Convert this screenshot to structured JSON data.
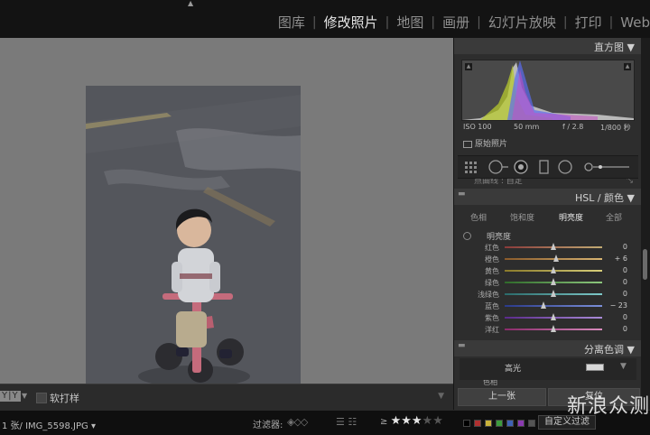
{
  "modules": [
    "图库",
    "修改照片",
    "地图",
    "画册",
    "幻灯片放映",
    "打印",
    "Web"
  ],
  "active_module": "修改照片",
  "toolbar": {
    "view_label": "Y|Y",
    "softproof_label": "软打样"
  },
  "filmstrip": {
    "file_info": "1 张/ IMG_5598.JPG",
    "filter_label": "过滤器:",
    "rating_op": "≥",
    "stars_on": 3,
    "stars_total": 5,
    "custom_filter": "自定义过滤",
    "label_colors": [
      "#000000",
      "#b03030",
      "#c9b23a",
      "#3d9b3d",
      "#3f62b5",
      "#8a3ab0",
      "#555555"
    ]
  },
  "histogram": {
    "panel_title": "直方图",
    "iso": "ISO 100",
    "focal": "50 mm",
    "aperture": "f / 2.8",
    "shutter": "1/800 秒",
    "original_label": "原始照片"
  },
  "tone_curve_cut": "点曲线 : 自定",
  "hsl": {
    "panel_title": "HSL / 颜色",
    "tabs": [
      "色相",
      "饱和度",
      "明亮度",
      "全部"
    ],
    "active_tab": "明亮度",
    "section_label": "明亮度",
    "rows": [
      {
        "label": "红色",
        "value": "0",
        "colors": [
          "#8a3a3a",
          "#c2ab73"
        ]
      },
      {
        "label": "橙色",
        "value": "+ 6",
        "colors": [
          "#8a5a2a",
          "#d9b572"
        ]
      },
      {
        "label": "黄色",
        "value": "0",
        "colors": [
          "#8a7a2a",
          "#d8cf7a"
        ]
      },
      {
        "label": "绿色",
        "value": "0",
        "colors": [
          "#2f6a2a",
          "#8dc77d"
        ]
      },
      {
        "label": "浅绿色",
        "value": "0",
        "colors": [
          "#2a6a6a",
          "#7ec9c9"
        ]
      },
      {
        "label": "蓝色",
        "value": "− 23",
        "colors": [
          "#2a3a8a",
          "#7b8fd8"
        ]
      },
      {
        "label": "紫色",
        "value": "0",
        "colors": [
          "#5a2a8a",
          "#a98bd8"
        ]
      },
      {
        "label": "洋红",
        "value": "0",
        "colors": [
          "#8a2a6a",
          "#d88bbd"
        ]
      }
    ],
    "slider_positions": [
      0.5,
      0.53,
      0.5,
      0.5,
      0.5,
      0.4,
      0.5,
      0.5
    ]
  },
  "split_toning": {
    "panel_title": "分离色调",
    "highlight_label": "高光",
    "hue_cut": "色相"
  },
  "nav": {
    "prev": "上一张",
    "reset": "复位"
  },
  "watermark": "新浪众测"
}
